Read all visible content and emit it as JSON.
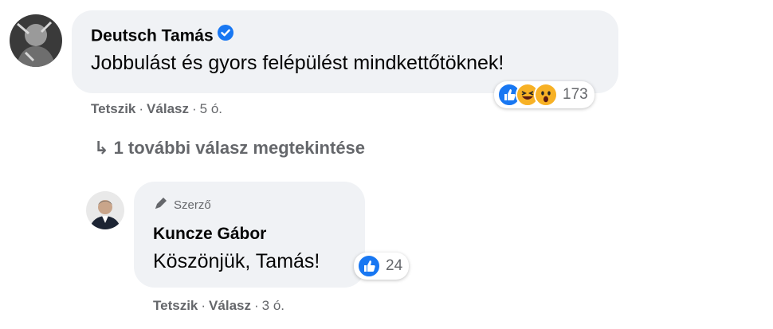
{
  "comment": {
    "author": "Deutsch Tamás",
    "text": "Jobbulást és gyors felépülést mindkettőtöknek!",
    "reaction_count": "173",
    "actions": {
      "like": "Tetszik",
      "reply": "Válasz",
      "time": "5 ó."
    }
  },
  "more_replies": "1 további válasz megtekintése",
  "reply": {
    "badge": "Szerző",
    "author": "Kuncze Gábor",
    "text": "Köszönjük, Tamás!",
    "reaction_count": "24",
    "actions": {
      "like": "Tetszik",
      "reply": "Válasz",
      "time": "3 ó."
    }
  },
  "colors": {
    "bubble": "#f0f2f5",
    "like_blue": "#1877f2",
    "muted": "#65676b",
    "haha_yellow": "#f7b125"
  }
}
